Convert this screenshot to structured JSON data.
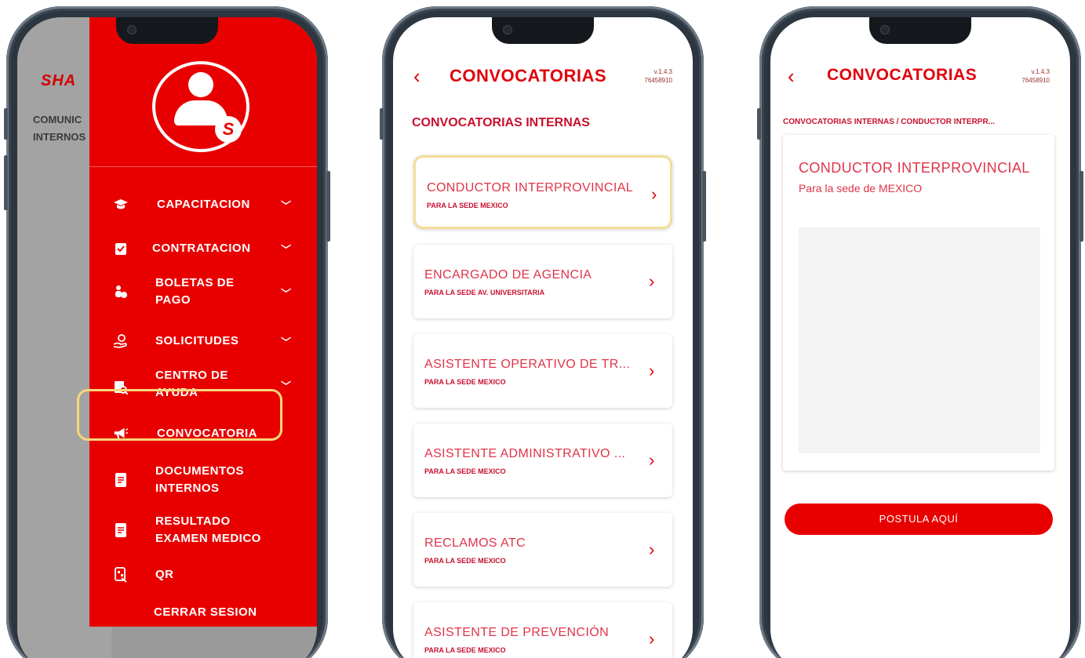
{
  "colors": {
    "brand_red": "#e80000",
    "highlight": "#f6d77a",
    "text_red": "#e0344a"
  },
  "phone1": {
    "background": {
      "logo": "SHA",
      "text_lines": [
        "COMUNIC",
        "INTERNOS"
      ]
    },
    "drawer": {
      "avatar_icon": "user-avatar-icon",
      "menu": [
        {
          "label": "CAPACITACION",
          "icon": "graduation-cap-icon",
          "has_chevron": true
        },
        {
          "label": "CONTRATACION",
          "icon": "clipboard-check-icon",
          "has_chevron": true
        },
        {
          "label": "BOLETAS DE\nPAGO",
          "icon": "payslip-icon",
          "has_chevron": true
        },
        {
          "label": "SOLICITUDES",
          "icon": "hand-request-icon",
          "has_chevron": true
        },
        {
          "label": "CENTRO DE\nAYUDA",
          "icon": "help-center-icon",
          "has_chevron": true
        },
        {
          "label": "CONVOCATORIA",
          "icon": "megaphone-icon",
          "has_chevron": false,
          "highlighted": true
        },
        {
          "label": "DOCUMENTOS\nINTERNOS",
          "icon": "document-icon",
          "has_chevron": false
        },
        {
          "label": "RESULTADO\nEXAMEN MEDICO",
          "icon": "medical-document-icon",
          "has_chevron": false
        },
        {
          "label": "QR",
          "icon": "qr-icon",
          "has_chevron": false
        },
        {
          "label": "CERRAR SESION",
          "icon": "",
          "has_chevron": false
        }
      ]
    }
  },
  "phone2": {
    "header": {
      "title": "CONVOCATORIAS",
      "version": "v.1.4.3",
      "code": "76458910"
    },
    "section_title": "CONVOCATORIAS INTERNAS",
    "cards": [
      {
        "title": "CONDUCTOR INTERPROVINCIAL",
        "subtitle": "PARA LA SEDE MEXICO",
        "selected": true
      },
      {
        "title": "ENCARGADO DE AGENCIA",
        "subtitle": "PARA LA SEDE AV. UNIVERSITARIA"
      },
      {
        "title": "ASISTENTE OPERATIVO DE TR...",
        "subtitle": "PARA LA SEDE MEXICO"
      },
      {
        "title": "ASISTENTE ADMINISTRATIVO ...",
        "subtitle": "PARA LA SEDE MEXICO"
      },
      {
        "title": "RECLAMOS ATC",
        "subtitle": "PARA LA SEDE MEXICO"
      },
      {
        "title": "ASISTENTE DE PREVENCIÓN",
        "subtitle": "PARA LA SEDE MEXICO"
      }
    ]
  },
  "phone3": {
    "header": {
      "title": "CONVOCATORIAS",
      "version": "v.1.4.3",
      "code": "76458910"
    },
    "breadcrumb": "CONVOCATORIAS INTERNAS / CONDUCTOR INTERPR...",
    "detail": {
      "title": "CONDUCTOR INTERPROVINCIAL",
      "subtitle": "Para la sede de MEXICO"
    },
    "apply_label": "POSTULA AQUÍ"
  }
}
